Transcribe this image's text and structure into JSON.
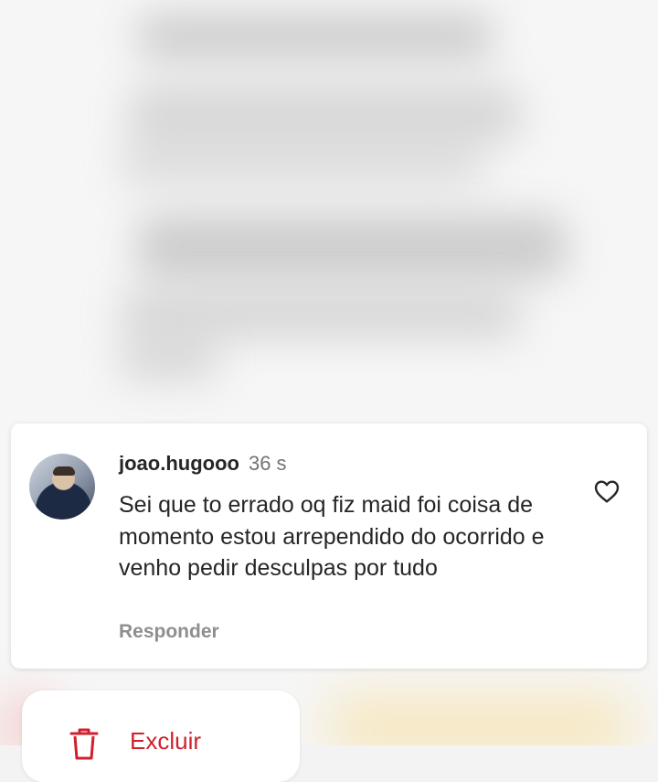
{
  "comment": {
    "username": "joao.hugooo",
    "time": "36 s",
    "text": "Sei que to errado oq fiz maid foi coisa de momento estou arrependido do ocorrido e venho pedir desculpas por tudo",
    "reply_label": "Responder"
  },
  "actions": {
    "delete_label": "Excluir"
  },
  "icons": {
    "like": "heart-icon",
    "delete": "trash-icon"
  },
  "colors": {
    "danger": "#d0202e",
    "username": "#262626",
    "muted": "#8e8e8e"
  }
}
